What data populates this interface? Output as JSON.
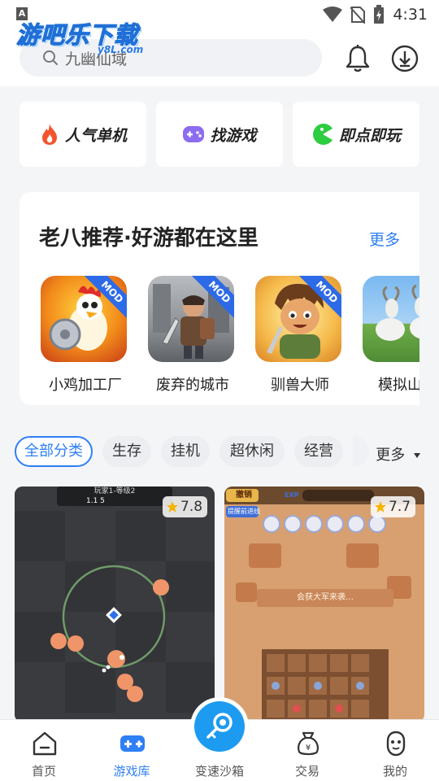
{
  "status_bar": {
    "time": "4:31",
    "badge": "A"
  },
  "header": {
    "logo": "游吧乐下载",
    "logo_sub": "y8L.com",
    "search_placeholder": "九幽仙域"
  },
  "quick_entries": [
    {
      "label": "人气单机",
      "icon": "fire-icon"
    },
    {
      "label": "找游戏",
      "icon": "gamepad-icon"
    },
    {
      "label": "即点即玩",
      "icon": "pacman-icon"
    }
  ],
  "recommend": {
    "title": "老八推荐·好游都在这里",
    "more": "更多",
    "badge": "MOD",
    "games": [
      {
        "name": "小鸡加工厂",
        "mod": true
      },
      {
        "name": "废弃的城市",
        "mod": true
      },
      {
        "name": "驯兽大师",
        "mod": true
      },
      {
        "name": "模拟山羊",
        "mod": false
      }
    ]
  },
  "categories": {
    "items": [
      "全部分类",
      "生存",
      "挂机",
      "超休闲",
      "经营"
    ],
    "active": 0,
    "more": "更多"
  },
  "tiles": [
    {
      "rating": "7.8",
      "hud": "玩家1-等级2",
      "stats": "1.1    5"
    },
    {
      "rating": "7.7",
      "btn_left": "撤销",
      "btn_link": "提醒前进线",
      "banner": "会获大军来袭…",
      "exp": "EXP"
    }
  ],
  "bottom_nav": [
    {
      "label": "首页",
      "icon": "home-icon",
      "active": false
    },
    {
      "label": "游戏库",
      "icon": "gamepad-icon",
      "active": true
    },
    {
      "label": "变速沙箱",
      "icon": "key-icon",
      "active": false
    },
    {
      "label": "交易",
      "icon": "money-bag-icon",
      "active": false
    },
    {
      "label": "我的",
      "icon": "profile-icon",
      "active": false
    }
  ],
  "colors": {
    "accent": "#2f7ff5",
    "fire": "#f2542d",
    "purple": "#8c6cf0",
    "green": "#2ecc40"
  }
}
